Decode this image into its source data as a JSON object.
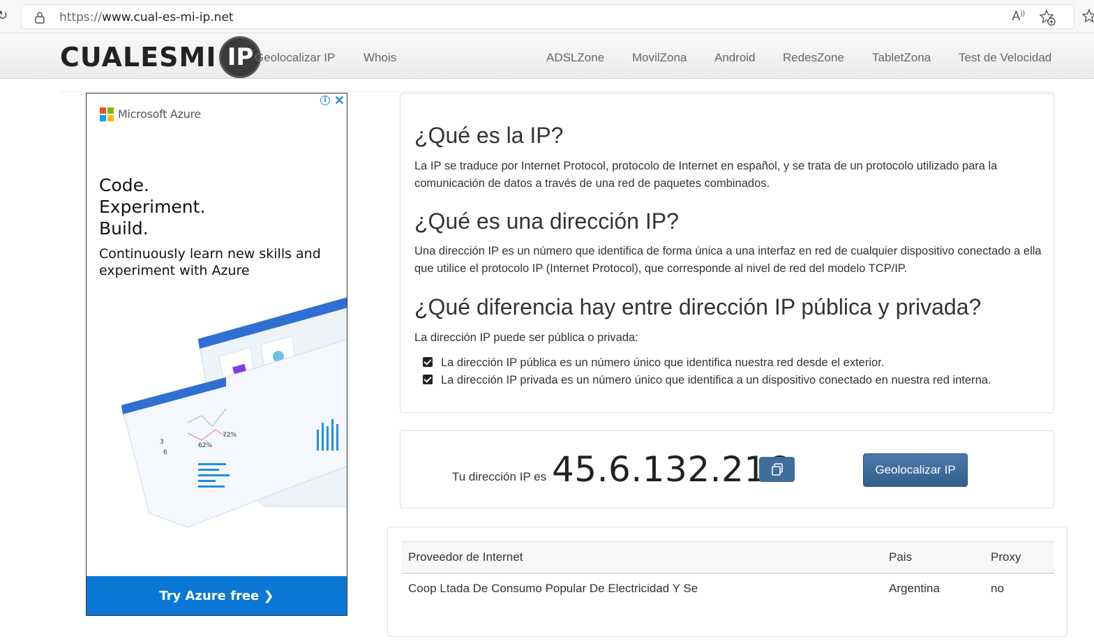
{
  "browser": {
    "url_scheme": "https://",
    "url_host": "www.cual-es-mi-ip.net"
  },
  "site": {
    "logo_text": "CUALESMI",
    "logo_badge": "IP",
    "nav_left": [
      "Geolocalizar IP",
      "Whois"
    ],
    "nav_right": [
      "ADSLZone",
      "MovilZona",
      "Android",
      "RedesZone",
      "TabletZona",
      "Test de Velocidad"
    ]
  },
  "ad": {
    "brand": "Microsoft Azure",
    "headline_1": "Code.",
    "headline_2": "Experiment.",
    "headline_3": "Build.",
    "subtext": "Continuously learn new skills and experiment with Azure",
    "cta": "Try Azure free ❯",
    "ms_colors": [
      "#f25022",
      "#7fba00",
      "#00a4ef",
      "#ffb900"
    ]
  },
  "info": {
    "h1": "¿Qué es la IP?",
    "p1": "La IP se traduce por Internet Protocol, protocolo de Internet en español, y se trata de un protocolo utilizado para la comunicación de datos a través de una red de paquetes combinados.",
    "h2": "¿Qué es una dirección IP?",
    "p2": "Una dirección IP es un número que identifica de forma única a una interfaz en red de cualquier dispositivo conectado a ella que utilice el protocolo IP (Internet Protocol), que corresponde al nivel de red del modelo TCP/IP.",
    "h3": "¿Qué diferencia hay entre dirección IP pública y privada?",
    "p3": "La dirección IP puede ser pública o privada:",
    "check_1": "La dirección IP pública es un número único que identifica nuestra red desde el exterior.",
    "check_2": "La dirección IP privada es un número único que identifica a un dispositivo conectado en nuestra red interna."
  },
  "ip": {
    "label": "Tu dirección IP es",
    "value": "45.6.132.216",
    "geo_button": "Geolocalizar IP"
  },
  "table": {
    "headers": [
      "Proveedor de Internet",
      "Pais",
      "Proxy"
    ],
    "rows": [
      [
        "Coop Ltada De Consumo Popular De Electricidad Y Se",
        "Argentina",
        "no"
      ]
    ]
  },
  "colors": {
    "accent": "#3f6d9e",
    "azure_blue": "#0a78d4"
  }
}
